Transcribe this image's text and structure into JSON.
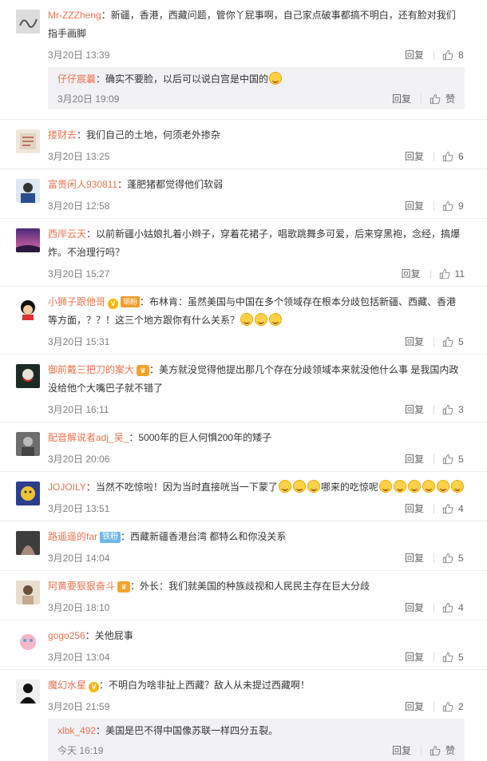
{
  "actions": {
    "reply_label": "回复",
    "like_label": "赞"
  },
  "comments": [
    {
      "user": "Mr-ZZZheng",
      "sep": "：",
      "text": "新疆，香港，西藏问题，管你丫屁事啊，自己家点破事都搞不明白，还有脸对我们指手画脚",
      "time": "3月20日 13:39",
      "likes": "8",
      "subreply": {
        "user": "仔仔宸曩",
        "sep": "：",
        "text": "确实不要脸，以后可以说白宫是中国的",
        "time": "3月20日 19:09",
        "likes": "赞"
      }
    },
    {
      "user": "搂财去",
      "sep": "：",
      "text": "我们自己的土地，何须老外掺杂",
      "time": "3月20日 13:25",
      "likes": "6"
    },
    {
      "user": "富贵闲人930811",
      "sep": "：",
      "text": "蓬肥猪都觉得他们软弱",
      "time": "3月20日 12:58",
      "likes": "9"
    },
    {
      "user": "西岸云天",
      "sep": "：",
      "text": "以前新疆小姑娘扎着小辫子，穿着花裙子，唱歌跳舞多可爱，后来穿黑袍，念经，搞爆炸。不治理行吗？",
      "time": "3月20日 15:27",
      "likes": "11"
    },
    {
      "user": "小狮子跟他哥",
      "badge_tag": "钢粉",
      "sep": "：",
      "text": "布林肯：虽然美国与中国在多个领域存在根本分歧包括新疆、西藏、香港等方面，？？！这三个地方跟你有什么关系？",
      "time": "3月20日 15:31",
      "likes": "5"
    },
    {
      "user": "御前戴三把刀的案大",
      "sep": "：",
      "text": "美方就没觉得他提出那几个存在分歧领域本来就没他什么事 是我国内政 没给他个大嘴巴子就不错了",
      "time": "3月20日 16:11",
      "likes": "3"
    },
    {
      "user": "配音解说者adj_吴_",
      "sep": "：",
      "text": "5000年的巨人何惧200年的矮子",
      "time": "3月20日 20:06",
      "likes": "5"
    },
    {
      "user": "JOJOILY",
      "sep": "：",
      "text": "当然不吃惊啦！因为当时直接咣当一下蒙了",
      "text2": "哪来的吃惊呢",
      "time": "3月20日 13:51",
      "likes": "4"
    },
    {
      "user": "路遥遥的far",
      "badge_tag": "铁粉",
      "sep": "：",
      "text": "西藏新疆香港台湾 都特么和你没关系",
      "time": "3月20日 14:04",
      "likes": "5"
    },
    {
      "user": "阿黄要狠狠奋斗",
      "sep": "：",
      "text": "外长：我们就美国的种族歧视和人民民主存在巨大分歧",
      "time": "3月20日 18:10",
      "likes": "4"
    },
    {
      "user": "gogo256",
      "sep": "：",
      "text": "关他屁事",
      "time": "3月20日 13:04",
      "likes": "5"
    },
    {
      "user": "魔幻水星",
      "sep": "：",
      "text": "不明白为啥非扯上西藏？敌人从未提过西藏啊！",
      "time": "3月20日 21:59",
      "likes": "2",
      "subreply": {
        "user": "xlbk_492",
        "sep": "：",
        "text": "美国是巴不得中国像苏联一样四分五裂。",
        "time": "今天 16:19",
        "likes": "赞"
      }
    }
  ]
}
